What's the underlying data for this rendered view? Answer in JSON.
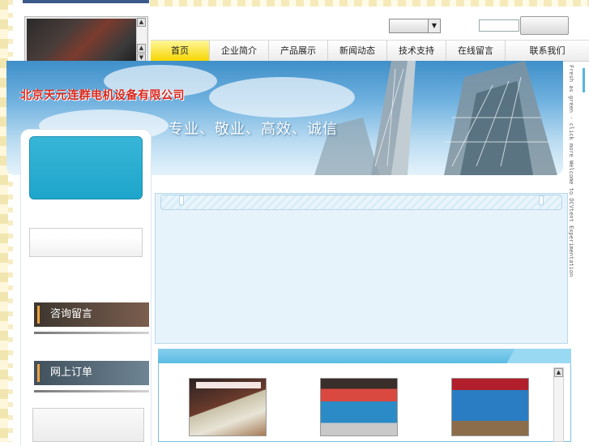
{
  "company": {
    "name": "北京天元连群电机设备有限公司",
    "slogan": "专业、敬业、高效、诚信",
    "vertical_tag": "Fresh as green - click more   Welcome to DCVtent Experimentation"
  },
  "nav": {
    "items": [
      {
        "label": "首页",
        "active": true
      },
      {
        "label": "企业简介",
        "active": false
      },
      {
        "label": "产品展示",
        "active": false
      },
      {
        "label": "新闻动态",
        "active": false
      },
      {
        "label": "技术支持",
        "active": false
      },
      {
        "label": "在线留言",
        "active": false
      },
      {
        "label": "联系我们",
        "active": false
      }
    ]
  },
  "header": {
    "select_value": "",
    "search_value": "",
    "search_button_label": ""
  },
  "sidebar": {
    "consult_label": "咨询留言",
    "order_label": "网上订单"
  },
  "colors": {
    "accent": "#1ea5cb",
    "nav_active": "#f7d600",
    "company_name": "#d8261b",
    "product_header": "#5cbbe3"
  }
}
